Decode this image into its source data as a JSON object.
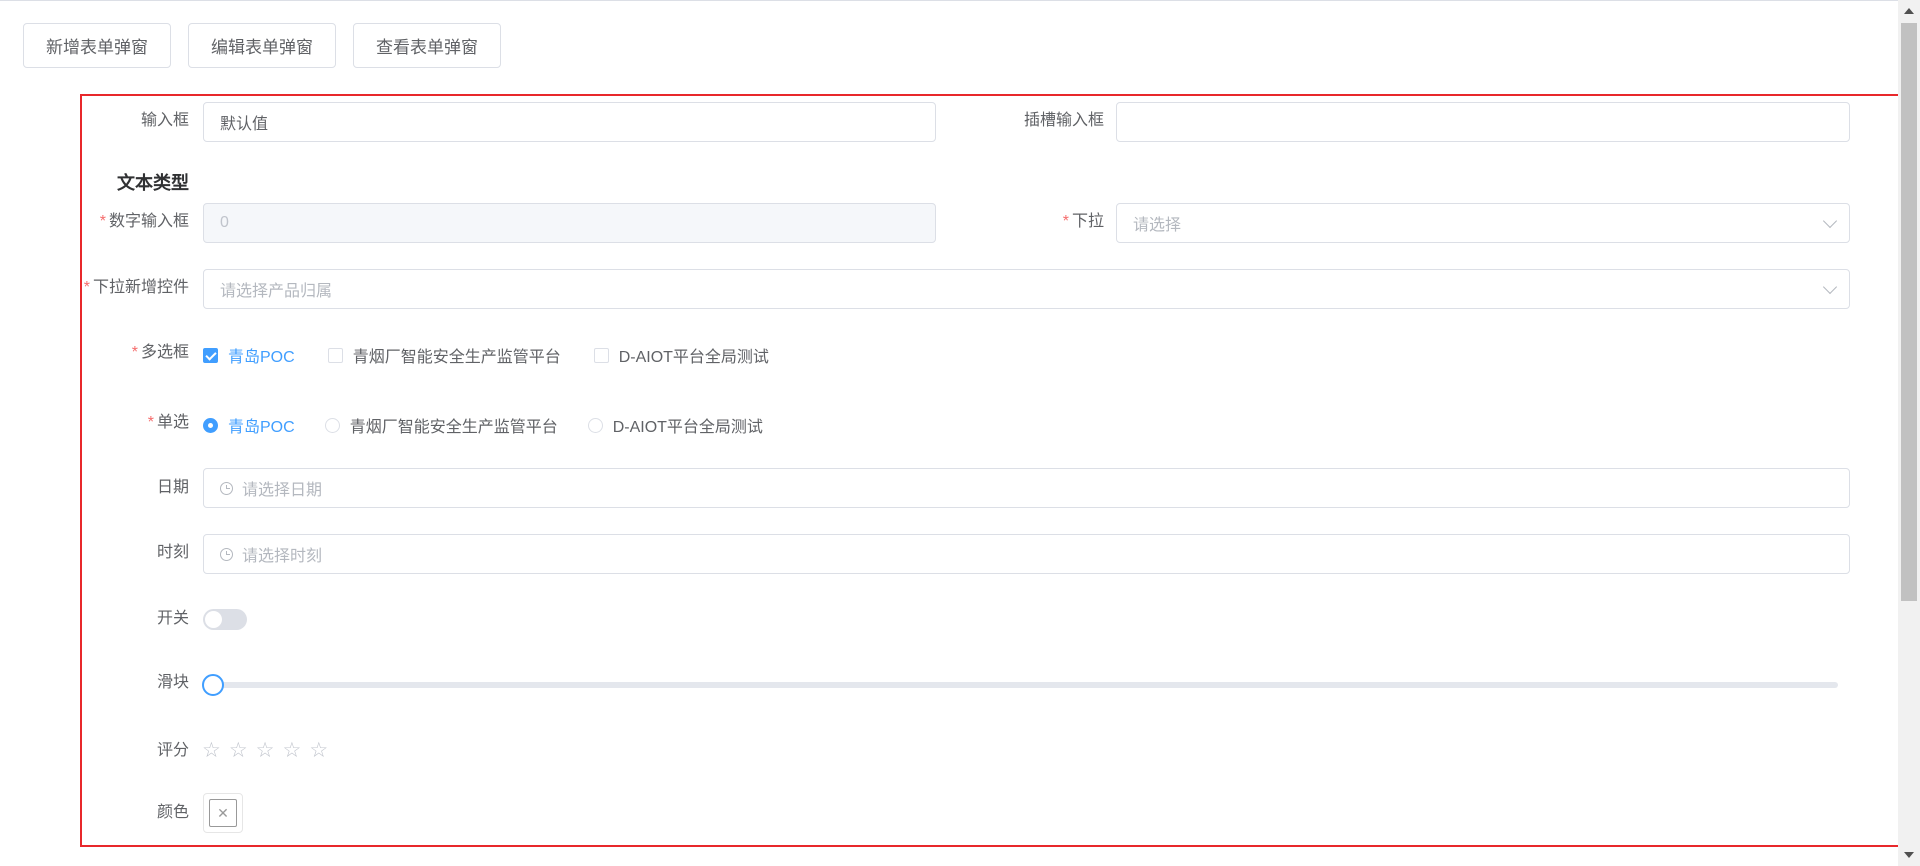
{
  "toolbar": {
    "add_label": "新增表单弹窗",
    "edit_label": "编辑表单弹窗",
    "view_label": "查看表单弹窗"
  },
  "form": {
    "input": {
      "label": "输入框",
      "value": "默认值"
    },
    "slot_input": {
      "label": "插槽输入框",
      "value": ""
    },
    "section_title": "文本类型",
    "number_input": {
      "label": "数字输入框",
      "value": "0",
      "required": "*"
    },
    "select": {
      "label": "下拉",
      "placeholder": "请选择",
      "required": "*"
    },
    "select_add": {
      "label": "下拉新增控件",
      "placeholder": "请选择产品归属",
      "required": "*"
    },
    "checkbox": {
      "label": "多选框",
      "required": "*",
      "options": [
        "青岛POC",
        "青烟厂智能安全生产监管平台",
        "D-AIOT平台全局测试"
      ],
      "checked": [
        true,
        false,
        false
      ]
    },
    "radio": {
      "label": "单选",
      "required": "*",
      "options": [
        "青岛POC",
        "青烟厂智能安全生产监管平台",
        "D-AIOT平台全局测试"
      ],
      "selected": 0
    },
    "date": {
      "label": "日期",
      "placeholder": "请选择日期",
      "icon": "clock-icon"
    },
    "time": {
      "label": "时刻",
      "placeholder": "请选择时刻",
      "icon": "clock-icon"
    },
    "switch": {
      "label": "开关",
      "on": false
    },
    "slider": {
      "label": "滑块",
      "value": 0
    },
    "rate": {
      "label": "评分",
      "value": 0,
      "max": 5
    },
    "color": {
      "label": "颜色",
      "value": "",
      "icon": "close-icon"
    }
  },
  "colors": {
    "primary": "#409eff",
    "required": "#f56c6c",
    "highlight_border": "#e8282b"
  }
}
